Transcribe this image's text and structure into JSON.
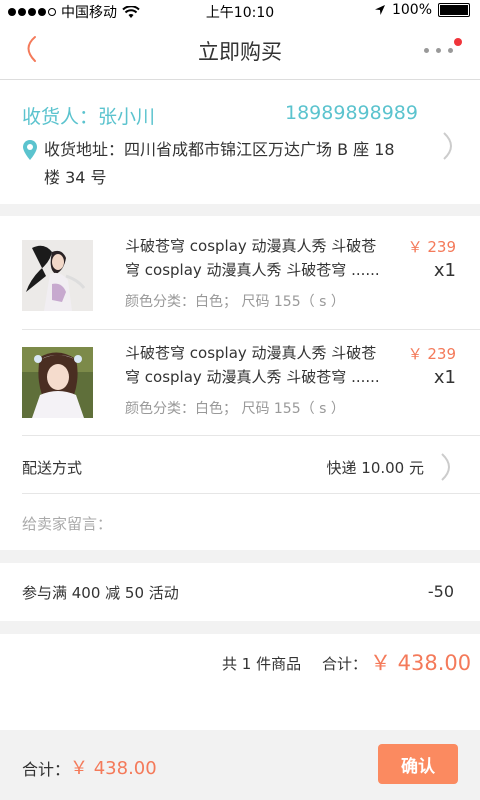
{
  "status_bar": {
    "carrier": "中国移动",
    "time": "上午10:10",
    "battery": "100%"
  },
  "nav": {
    "title": "立即购买"
  },
  "address": {
    "name": "收货人：张小川",
    "phone": "18989898989",
    "address": "收货地址：四川省成都市锦江区万达广场 B 座 18 楼 34 号"
  },
  "items": [
    {
      "title": "斗破苍穹 cosplay 动漫真人秀  斗破苍穹 cosplay 动漫真人秀  斗破苍穹 ......",
      "spec": "颜色分类：白色；  尺码 155（ s ）",
      "price": "￥ 239",
      "qty": "x1"
    },
    {
      "title": "斗破苍穹 cosplay 动漫真人秀  斗破苍穹 cosplay 动漫真人秀  斗破苍穹 ......",
      "spec": "颜色分类：白色；  尺码 155（ s ）",
      "price": "￥ 239",
      "qty": "x1"
    }
  ],
  "shipping": {
    "label": "配送方式",
    "value": "快递 10.00 元"
  },
  "memo": {
    "placeholder": "给卖家留言："
  },
  "promo": {
    "label": "参与满 400 减 50 活动",
    "value": "-50"
  },
  "summary": {
    "count": "共 1 件商品",
    "total_label": "合计：",
    "total": "￥ 438.00"
  },
  "bottom": {
    "total_label": "合计：",
    "total": "￥ 438.00",
    "confirm": "确认"
  },
  "colors": {
    "accent": "#f47a5a",
    "teal": "#5bc3ce",
    "button": "#fb8a60"
  },
  "icons": [
    "back-icon",
    "more-icon",
    "location-pin-icon",
    "chevron-right-icon"
  ]
}
